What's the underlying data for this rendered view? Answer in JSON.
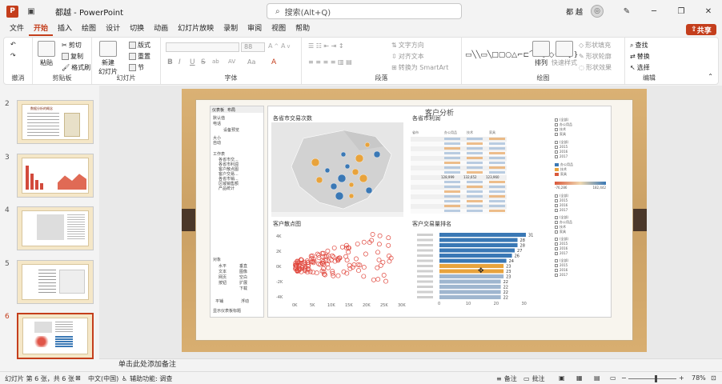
{
  "app": {
    "doc_title": "都越",
    "app_name": "PowerPoint",
    "search_placeholder": "搜索(Alt+Q)",
    "user": "都 越"
  },
  "tabs": [
    "文件",
    "开始",
    "插入",
    "绘图",
    "设计",
    "切换",
    "动画",
    "幻灯片放映",
    "录制",
    "审阅",
    "视图",
    "帮助"
  ],
  "active_tab": "开始",
  "share_label": "共享",
  "ribbon": {
    "undo_label": "撤消",
    "clipboard": {
      "paste": "粘贴",
      "cut": "剪切",
      "copy": "复制",
      "format_painter": "格式刷",
      "label": "剪贴板"
    },
    "slides": {
      "new_slide": "新建\n幻灯片",
      "layout": "版式",
      "reset": "重置",
      "section": "节",
      "label": "幻灯片"
    },
    "font": {
      "name_value": "",
      "size_value": "88",
      "label": "字体",
      "buttons": [
        "B",
        "I",
        "U",
        "S",
        "ab",
        "AV",
        "Aa",
        "A"
      ]
    },
    "paragraph": {
      "text_direction": "文字方向",
      "align_text": "对齐文本",
      "smartart": "转换为 SmartArt",
      "label": "段落"
    },
    "drawing": {
      "arrange": "排列",
      "quick_styles": "快速样式",
      "shape_fill": "形状填充",
      "shape_outline": "形状轮廓",
      "shape_effects": "形状效果",
      "label": "绘图"
    },
    "editing": {
      "find": "查找",
      "replace": "替换",
      "select": "选择",
      "label": "编辑"
    }
  },
  "thumbnails": [
    {
      "num": "2",
      "caption": "数据分析的概念"
    },
    {
      "num": "3",
      "caption": ""
    },
    {
      "num": "4",
      "caption": ""
    },
    {
      "num": "5",
      "caption": ""
    },
    {
      "num": "6",
      "caption": ""
    }
  ],
  "active_slide": "6",
  "slide": {
    "dashboard_title": "客户分析",
    "panel_tabs": [
      "仪表板",
      "布局"
    ],
    "panel_lines": [
      "默认值",
      "电话",
      "设备预览",
      "大小",
      "自动",
      "工作表",
      "各省市交...",
      "各省市利润",
      "客户散点图",
      "客户交易...",
      "各省市销...",
      "区域销售额",
      "产品统计",
      "对象",
      "水平",
      "垂直",
      "文本",
      "图像",
      "网页",
      "空白",
      "按钮",
      "扩展",
      "下载",
      "平铺",
      "浮动",
      "显示仪表板标题"
    ],
    "sheets": {
      "map_title": "各省市交易次数",
      "table_title": "各省市利润",
      "scatter_title": "客户散点图",
      "bars_title": "客户交易量排名"
    },
    "table": {
      "headers": [
        "省市",
        "办公用品",
        "技术",
        "家具"
      ],
      "values": [
        "128,999",
        "132,652",
        "123,960"
      ]
    },
    "bar_values": [
      31,
      28,
      28,
      27,
      26,
      24,
      23,
      23,
      23,
      22,
      22,
      22,
      22
    ],
    "bar_axis": [
      "0",
      "10",
      "20",
      "30"
    ],
    "scatter_axis_x": [
      "0K",
      "5K",
      "10K",
      "15K",
      "20K",
      "25K",
      "30K"
    ],
    "scatter_axis_y": [
      "4K",
      "2K",
      "0K",
      "-2K",
      "-4K"
    ],
    "legend_years": [
      "2015",
      "2016",
      "2017"
    ],
    "legend_cats": [
      "办公用品",
      "技术",
      "家具"
    ],
    "legend_range": [
      "-76,286",
      "182,442"
    ]
  },
  "notes_placeholder": "单击此处添加备注",
  "status": {
    "slide_info": "幻灯片 第 6 张，共 6 张",
    "language": "中文(中国)",
    "accessibility": "辅助功能: 调查",
    "notes_btn": "备注",
    "comments_btn": "批注",
    "zoom": "78%"
  },
  "colors": {
    "accent": "#c43e1c",
    "bar_blue": "#3a78b5",
    "bar_orange": "#e8a33c",
    "scatter_red": "#e0463c"
  }
}
